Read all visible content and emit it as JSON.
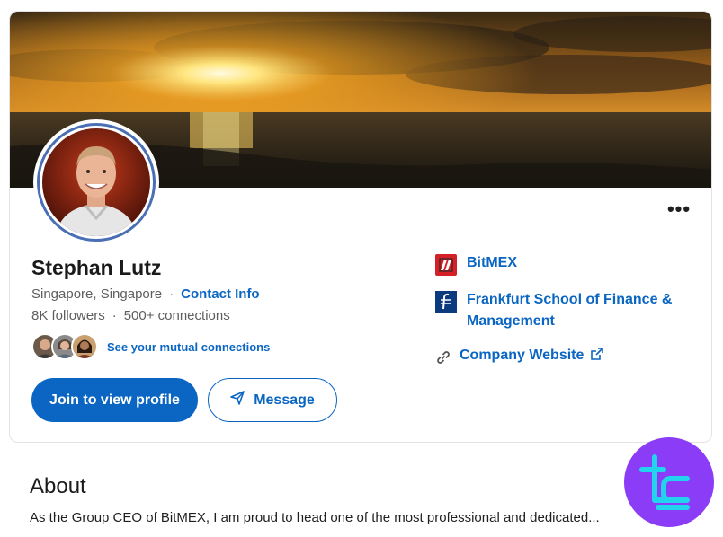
{
  "profile": {
    "name": "Stephan Lutz",
    "location": "Singapore, Singapore",
    "contact_info": "Contact Info",
    "followers": "8K followers",
    "connections": "500+ connections",
    "mutual_link": "See your mutual connections"
  },
  "actions": {
    "join_label": "Join to view profile",
    "message_label": "Message",
    "more_label": "•••"
  },
  "organizations": [
    {
      "name": "BitMEX",
      "icon": "bitmex-logo",
      "color": "#d62027"
    },
    {
      "name": "Frankfurt School of Finance & Management",
      "icon": "frankfurt-school-logo",
      "color": "#0b3a7e"
    },
    {
      "name": "Company Website",
      "icon": "link-icon",
      "external_icon": "external-link-icon"
    }
  ],
  "about": {
    "title": "About",
    "text": "As the Group CEO of BitMEX, I am proud to head one of the most professional and dedicated..."
  },
  "colors": {
    "accent": "#0a66c2",
    "avatar_ring": "#4a6fb5",
    "watermark_bg": "#8b3cf7",
    "watermark_fg": "#22d3ee"
  }
}
